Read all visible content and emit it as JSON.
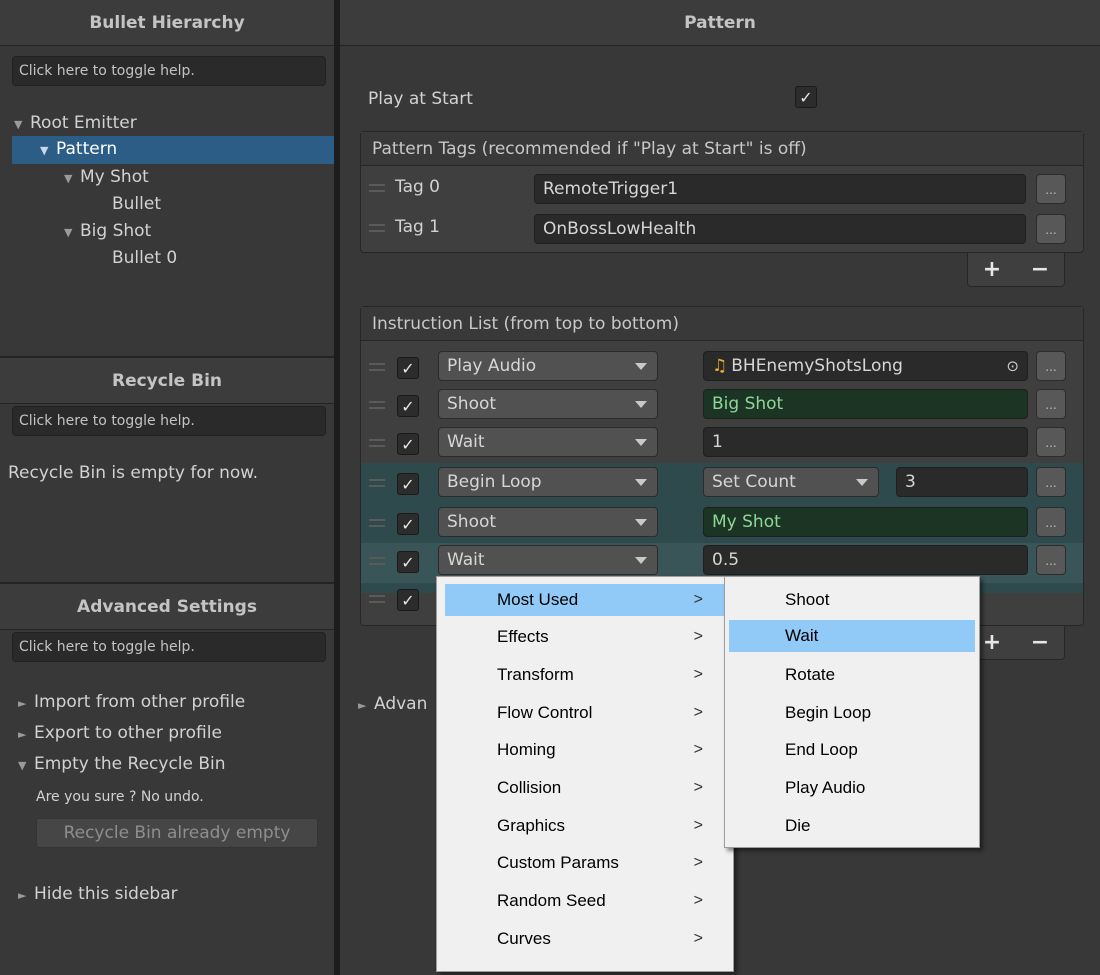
{
  "sidebar": {
    "hierarchy_title": "Bullet Hierarchy",
    "help_label": "Click here to toggle help.",
    "tree": [
      {
        "label": "Root Emitter",
        "expanded": true,
        "selected": false
      },
      {
        "label": "Pattern",
        "expanded": true,
        "selected": true
      },
      {
        "label": "My Shot",
        "expanded": true,
        "selected": false
      },
      {
        "label": "Bullet",
        "expanded": false,
        "selected": false
      },
      {
        "label": "Big Shot",
        "expanded": true,
        "selected": false
      },
      {
        "label": "Bullet 0",
        "expanded": false,
        "selected": false
      }
    ],
    "recycle_title": "Recycle Bin",
    "recycle_empty_text": "Recycle Bin is empty for now.",
    "advanced_title": "Advanced Settings",
    "advanced_items": {
      "import": "Import from other profile",
      "export": "Export to other profile",
      "empty_bin": "Empty the Recycle Bin",
      "confirm": "Are you sure ? No undo.",
      "empty_button": "Recycle Bin already empty",
      "hide_sidebar": "Hide this sidebar"
    }
  },
  "main": {
    "title": "Pattern",
    "play_at_start_label": "Play at Start",
    "play_at_start_checked": true,
    "tags_title": "Pattern Tags (recommended if \"Play at Start\" is off)",
    "tags": [
      {
        "label": "Tag 0",
        "value": "RemoteTrigger1"
      },
      {
        "label": "Tag 1",
        "value": "OnBossLowHealth"
      }
    ],
    "instructions_title": "Instruction List (from top to bottom)",
    "instructions": [
      {
        "action": "Play Audio",
        "param": "BHEnemyShotsLong",
        "param_icon": "music-note-icon"
      },
      {
        "action": "Shoot",
        "param": "Big Shot"
      },
      {
        "action": "Wait",
        "param": "1"
      },
      {
        "action": "Begin Loop",
        "param_mode": "Set Count",
        "param": "3"
      },
      {
        "action": "Shoot",
        "param": "My Shot"
      },
      {
        "action": "Wait",
        "param": "0.5"
      },
      {
        "action": "",
        "param": ""
      }
    ],
    "advanced_partial": "Advan",
    "dots": "...",
    "plus": "+",
    "minus": "−"
  },
  "context_menu": {
    "categories": [
      "Most Used",
      "Effects",
      "Transform",
      "Flow Control",
      "Homing",
      "Collision",
      "Graphics",
      "Custom Params",
      "Random Seed",
      "Curves"
    ],
    "highlighted_category": "Most Used",
    "submenu": [
      "Shoot",
      "Wait",
      "Rotate",
      "Begin Loop",
      "End Loop",
      "Play Audio",
      "Die"
    ],
    "highlighted_item": "Wait",
    "chevron": ">"
  },
  "colors": {
    "selection": "#2c5d87",
    "menu_highlight": "#91c9f7",
    "green_field_text": "#8ed69a",
    "loop_tint": "#2f4a4c"
  }
}
